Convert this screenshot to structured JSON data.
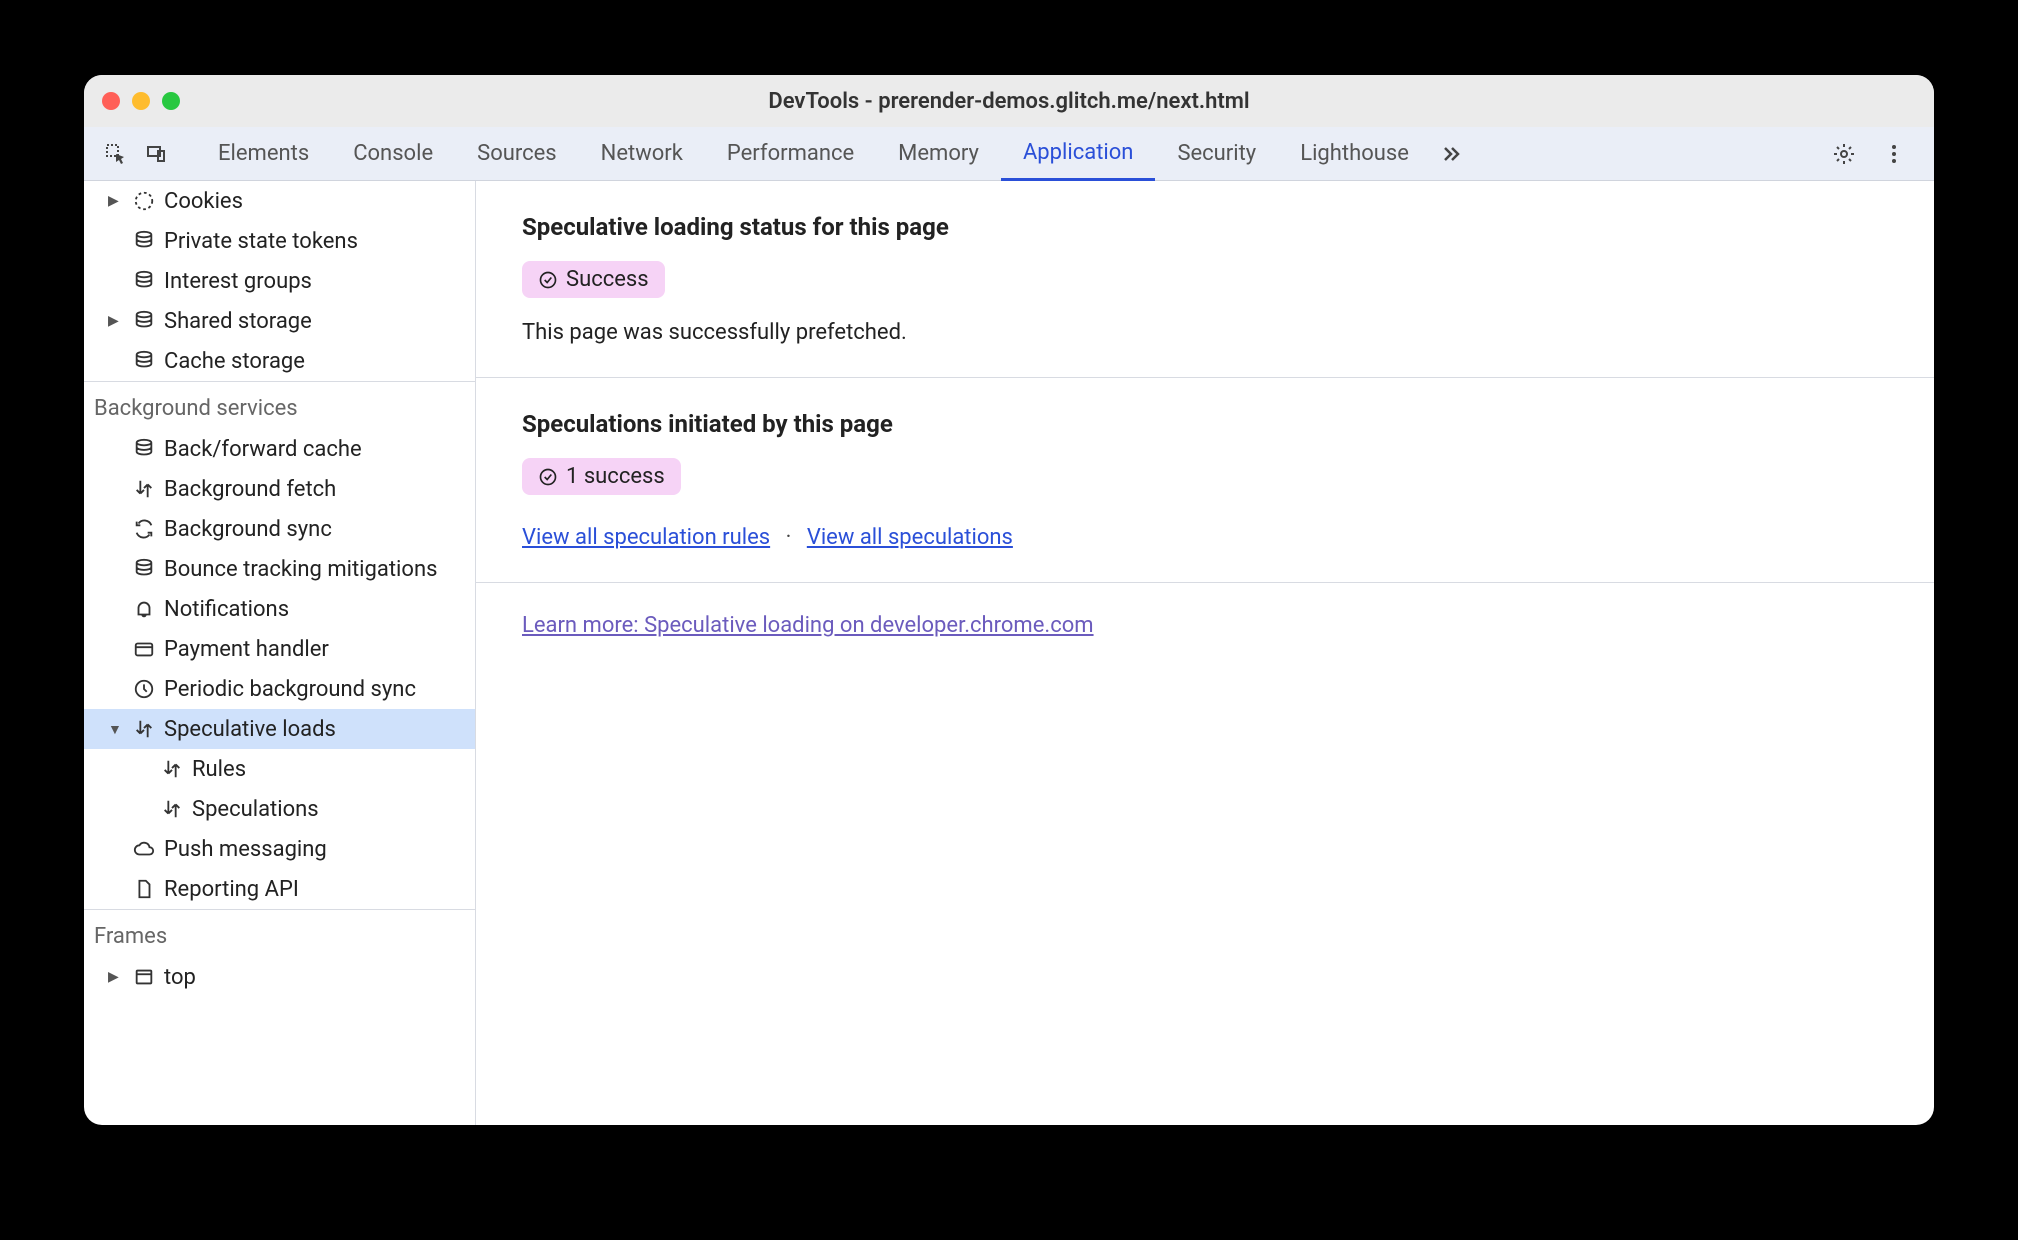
{
  "window": {
    "title": "DevTools - prerender-demos.glitch.me/next.html"
  },
  "tabs": {
    "items": [
      "Elements",
      "Console",
      "Sources",
      "Network",
      "Performance",
      "Memory",
      "Application",
      "Security",
      "Lighthouse"
    ],
    "active": "Application"
  },
  "sidebar": {
    "storage_items": [
      {
        "label": "Cookies",
        "icon": "cookie",
        "expandable": true
      },
      {
        "label": "Private state tokens",
        "icon": "db"
      },
      {
        "label": "Interest groups",
        "icon": "db"
      },
      {
        "label": "Shared storage",
        "icon": "db",
        "expandable": true
      },
      {
        "label": "Cache storage",
        "icon": "db"
      }
    ],
    "bg_section": "Background services",
    "bg_items": [
      {
        "label": "Back/forward cache",
        "icon": "db"
      },
      {
        "label": "Background fetch",
        "icon": "arrows"
      },
      {
        "label": "Background sync",
        "icon": "sync"
      },
      {
        "label": "Bounce tracking mitigations",
        "icon": "db"
      },
      {
        "label": "Notifications",
        "icon": "bell"
      },
      {
        "label": "Payment handler",
        "icon": "card"
      },
      {
        "label": "Periodic background sync",
        "icon": "clock"
      },
      {
        "label": "Speculative loads",
        "icon": "arrows",
        "expanded": true,
        "selected": true,
        "children": [
          {
            "label": "Rules",
            "icon": "arrows"
          },
          {
            "label": "Speculations",
            "icon": "arrows"
          }
        ]
      },
      {
        "label": "Push messaging",
        "icon": "cloud"
      },
      {
        "label": "Reporting API",
        "icon": "doc"
      }
    ],
    "frames_section": "Frames",
    "frames_items": [
      {
        "label": "top",
        "icon": "frame",
        "expandable": true
      }
    ]
  },
  "main": {
    "status_heading": "Speculative loading status for this page",
    "status_badge": "Success",
    "status_desc": "This page was successfully prefetched.",
    "spec_heading": "Speculations initiated by this page",
    "spec_badge": "1 success",
    "link_rules": "View all speculation rules",
    "link_specs": "View all speculations",
    "link_sep": "·",
    "learn_more": "Learn more: Speculative loading on developer.chrome.com"
  }
}
